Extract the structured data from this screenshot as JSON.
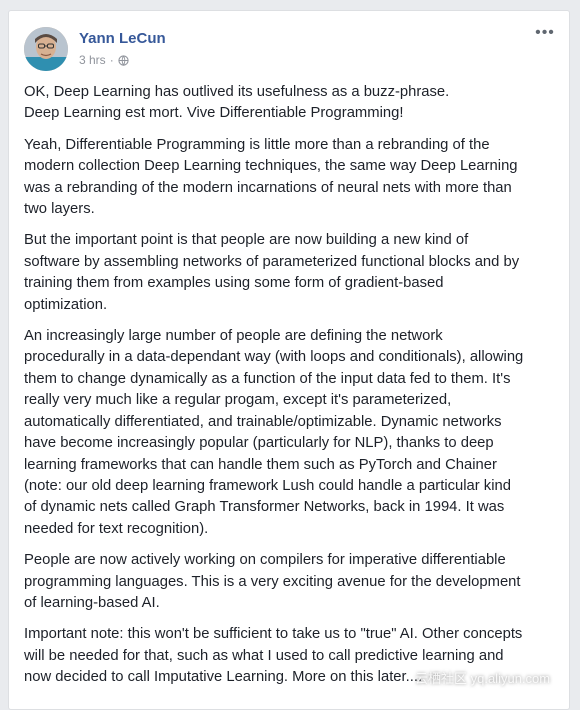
{
  "post": {
    "author": "Yann LeCun",
    "time": "3 hrs",
    "dots": "·",
    "more_label": "•••",
    "paragraphs": [
      [
        "OK, Deep Learning has outlived its usefulness as a buzz-phrase.",
        "Deep Learning est mort. Vive Differentiable Programming!"
      ],
      [
        "Yeah, Differentiable Programming is little more than a rebranding of the",
        "modern collection Deep Learning techniques, the same way Deep Learning",
        "was a rebranding of the modern incarnations of neural nets with more than",
        "two layers."
      ],
      [
        "But the important point is that people are now building a new kind of",
        "software by assembling networks of parameterized functional blocks and by",
        "training them from examples using some form of gradient-based",
        "optimization."
      ],
      [
        "An increasingly large number of people are defining the network",
        "procedurally in a data-dependant way (with loops and conditionals), allowing",
        "them to change dynamically as a function of the input data fed to them. It's",
        "really very much like a regular progam, except it's parameterized,",
        "automatically differentiated, and trainable/optimizable. Dynamic networks",
        "have become increasingly popular (particularly for NLP), thanks to deep",
        "learning frameworks that can handle them such as PyTorch and Chainer",
        "(note: our old deep learning framework Lush could handle a particular kind",
        "of dynamic nets called Graph Transformer Networks, back in 1994. It was",
        "needed for text recognition)."
      ],
      [
        "People are now actively working on compilers for imperative differentiable",
        "programming languages. This is a very exciting avenue for the development",
        "of learning-based AI."
      ],
      [
        "Important note: this won't be sufficient to take us to \"true\" AI. Other concepts",
        "will be needed for that, such as what I used to call predictive learning and",
        "now decided to call Imputative Learning. More on this later...."
      ]
    ]
  },
  "watermark": "云栖社区 yq.aliyun.com",
  "colors": {
    "author": "#365899",
    "text": "#1d2129",
    "meta": "#90949c",
    "background": "#e9ebee"
  },
  "icons": {
    "privacy": "globe-icon",
    "menu": "more-options-icon"
  }
}
